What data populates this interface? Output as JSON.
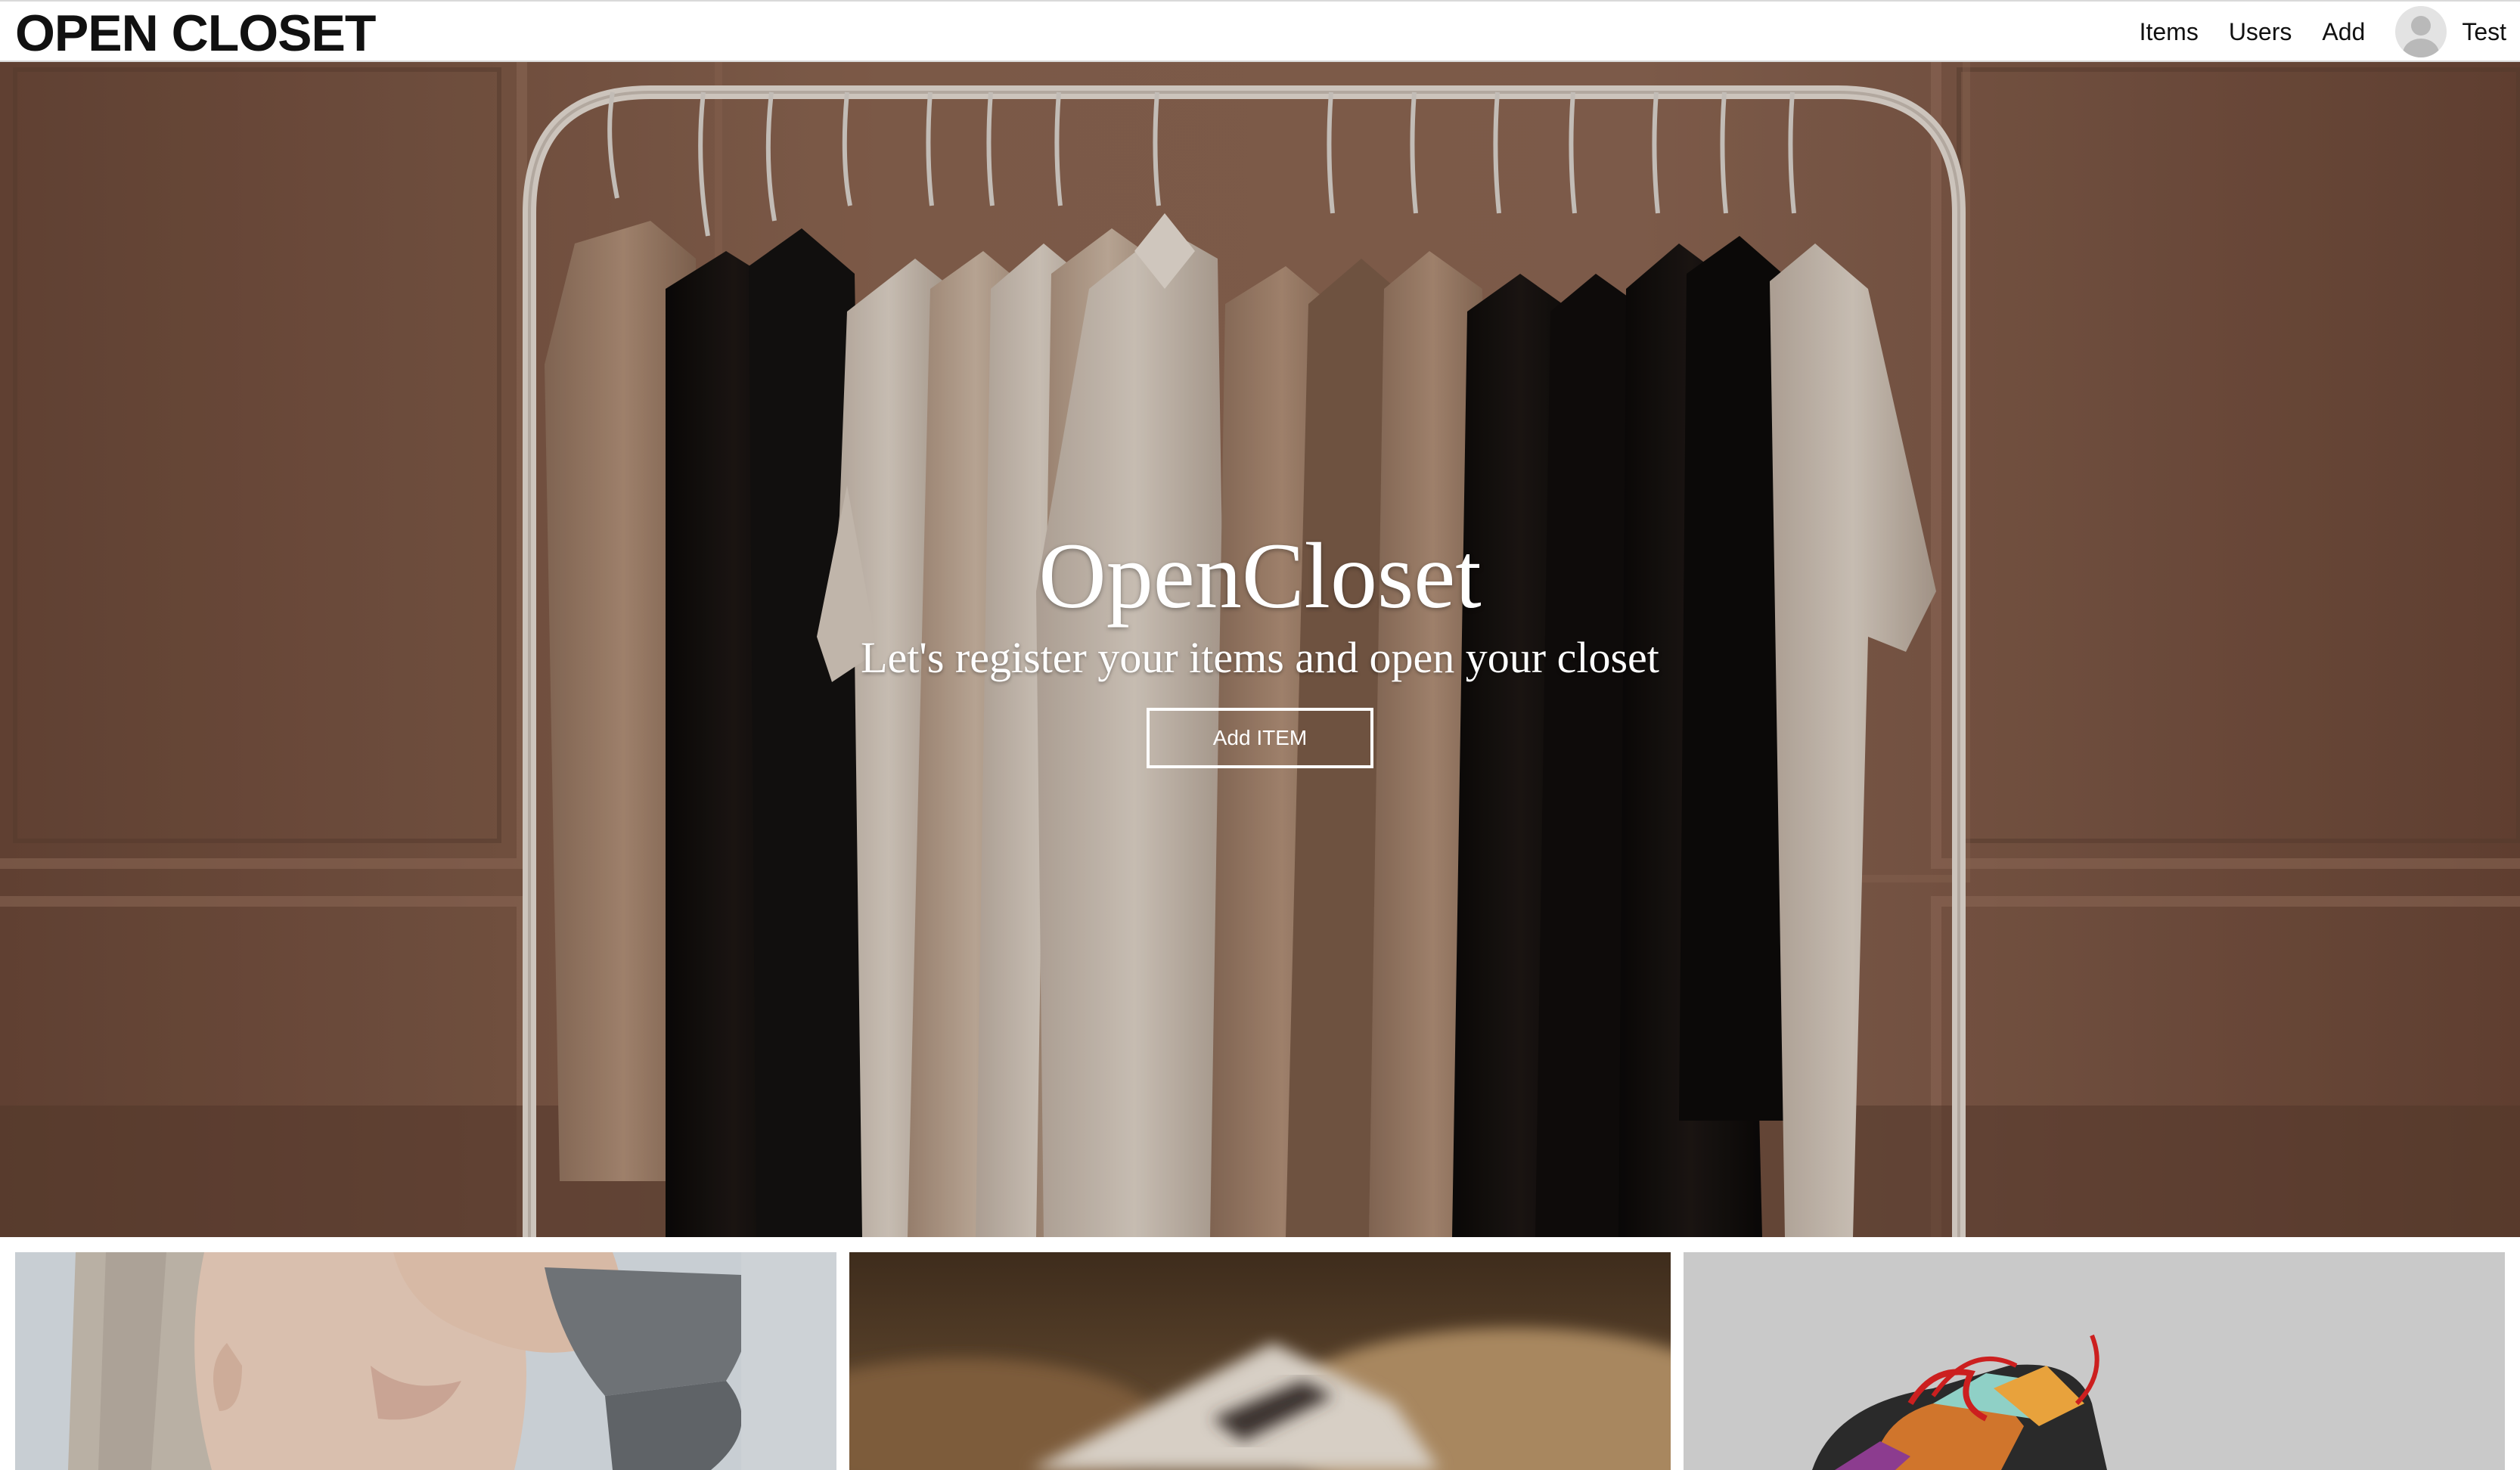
{
  "nav": {
    "brand": "OPEN CLOSET",
    "links": [
      "Items",
      "Users",
      "Add"
    ],
    "user_name": "Test"
  },
  "hero": {
    "title": "OpenCloset",
    "subtitle": "Let's register your items and open your closet",
    "button_label": "Add ITEM"
  },
  "cards": [
    {
      "image": "woman-covering-eyes-photo"
    },
    {
      "image": "blurred-book-photo"
    },
    {
      "image": "sneaker-photo"
    }
  ],
  "colors": {
    "hero_background": "#7a5644",
    "navbar_background": "#ffffff",
    "text_dark": "#111111"
  }
}
